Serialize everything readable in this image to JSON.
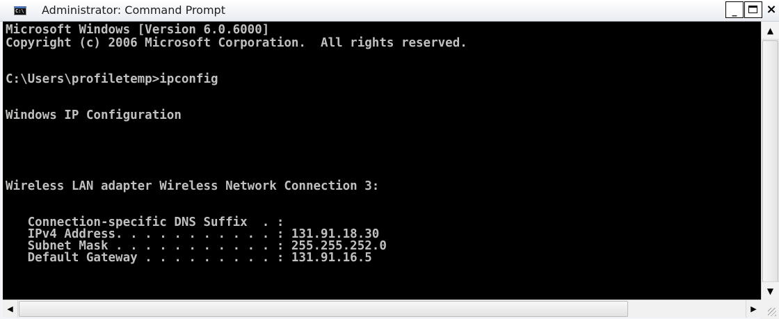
{
  "window": {
    "title": "Administrator: Command Prompt",
    "icon": "cmd-icon",
    "icon_text": "C:\\",
    "buttons": {
      "minimize_label": "_",
      "maximize_icon": "maximize-icon",
      "close_label": "×"
    }
  },
  "console": {
    "lines": [
      "Microsoft Windows [Version 6.0.6000]",
      "Copyright (c) 2006 Microsoft Corporation.  All rights reserved.",
      "C:\\Users\\profiletemp>ipconfig",
      "Windows IP Configuration",
      "Wireless LAN adapter Wireless Network Connection 3:",
      "   Connection-specific DNS Suffix  . :",
      "   IPv4 Address. . . . . . . . . . . : 131.91.18.30",
      "   Subnet Mask . . . . . . . . . . . : 255.255.252.0",
      "   Default Gateway . . . . . . . . . : 131.91.16.5"
    ],
    "colors": {
      "background": "#000000",
      "foreground": "#c0c0c0"
    }
  },
  "scrollbars": {
    "vertical": {
      "up_arrow": "▲",
      "down_arrow": "▼"
    },
    "horizontal": {
      "left_arrow": "◀",
      "right_arrow": "▶"
    }
  }
}
